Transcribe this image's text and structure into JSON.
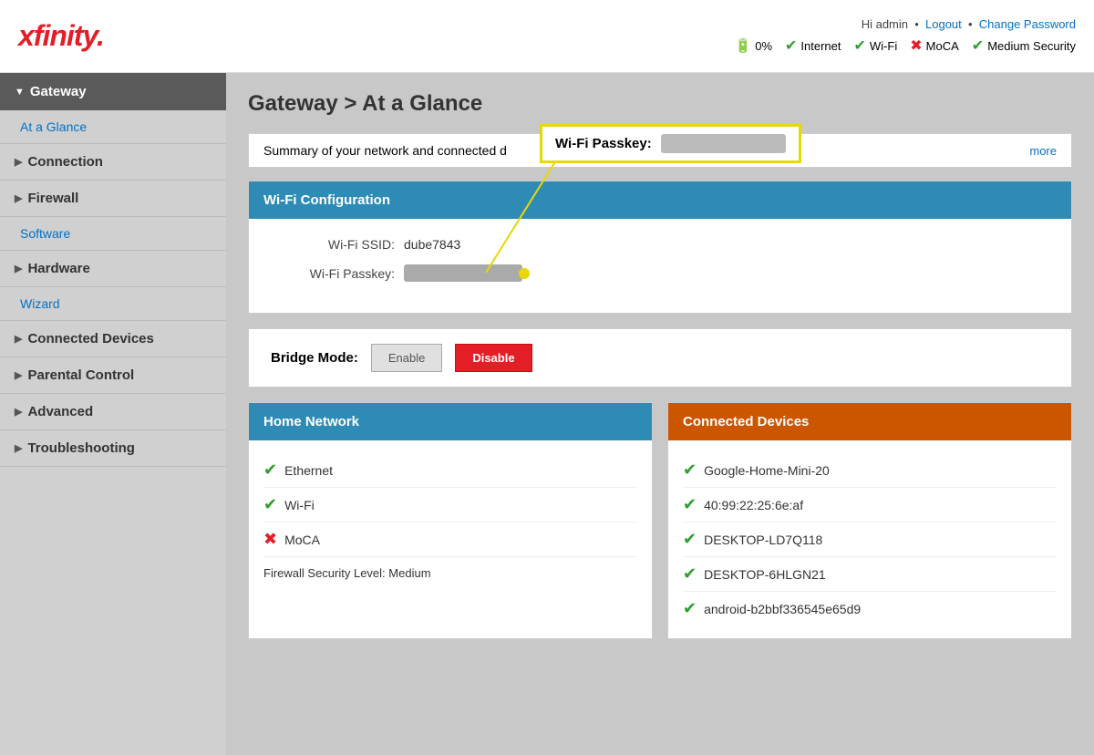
{
  "header": {
    "logo": "xfinity.",
    "user_greeting": "Hi admin",
    "logout_label": "Logout",
    "change_password_label": "Change Password",
    "status_items": [
      {
        "label": "0%",
        "icon": "battery",
        "icon_type": "battery"
      },
      {
        "label": "Internet",
        "icon": "✔",
        "icon_type": "check"
      },
      {
        "label": "Wi-Fi",
        "icon": "✔",
        "icon_type": "check"
      },
      {
        "label": "MoCA",
        "icon": "✖",
        "icon_type": "x"
      },
      {
        "label": "Medium Security",
        "icon": "✔",
        "icon_type": "check"
      }
    ]
  },
  "sidebar": {
    "gateway_label": "Gateway",
    "at_a_glance_label": "At a Glance",
    "connection_label": "Connection",
    "firewall_label": "Firewall",
    "software_label": "Software",
    "hardware_label": "Hardware",
    "wizard_label": "Wizard",
    "connected_devices_label": "Connected Devices",
    "parental_control_label": "Parental Control",
    "advanced_label": "Advanced",
    "troubleshooting_label": "Troubleshooting"
  },
  "main": {
    "page_title": "Gateway > At a Glance",
    "summary_text": "Summary of your network and connected d",
    "more_link": "more",
    "passkey_callout_label": "Wi-Fi Passkey:",
    "passkey_callout_value": "••••••••••",
    "wifi_config": {
      "header": "Wi-Fi Configuration",
      "ssid_label": "Wi-Fi SSID:",
      "ssid_value": "dube7843",
      "passkey_label": "Wi-Fi Passkey:",
      "passkey_value": "••••••••"
    },
    "bridge_mode": {
      "label": "Bridge Mode:",
      "enable_label": "Enable",
      "disable_label": "Disable"
    },
    "home_network": {
      "header": "Home Network",
      "items": [
        {
          "label": "Ethernet",
          "status": "check"
        },
        {
          "label": "Wi-Fi",
          "status": "check"
        },
        {
          "label": "MoCA",
          "status": "x"
        }
      ],
      "firewall_label": "Firewall Security Level:",
      "firewall_value": "Medium"
    },
    "connected_devices": {
      "header": "Connected Devices",
      "items": [
        {
          "label": "Google-Home-Mini-20",
          "status": "check"
        },
        {
          "label": "40:99:22:25:6e:af",
          "status": "check"
        },
        {
          "label": "DESKTOP-LD7Q118",
          "status": "check"
        },
        {
          "label": "DESKTOP-6HLGN21",
          "status": "check"
        },
        {
          "label": "android-b2bbf336545e65d9",
          "status": "check"
        }
      ]
    }
  }
}
